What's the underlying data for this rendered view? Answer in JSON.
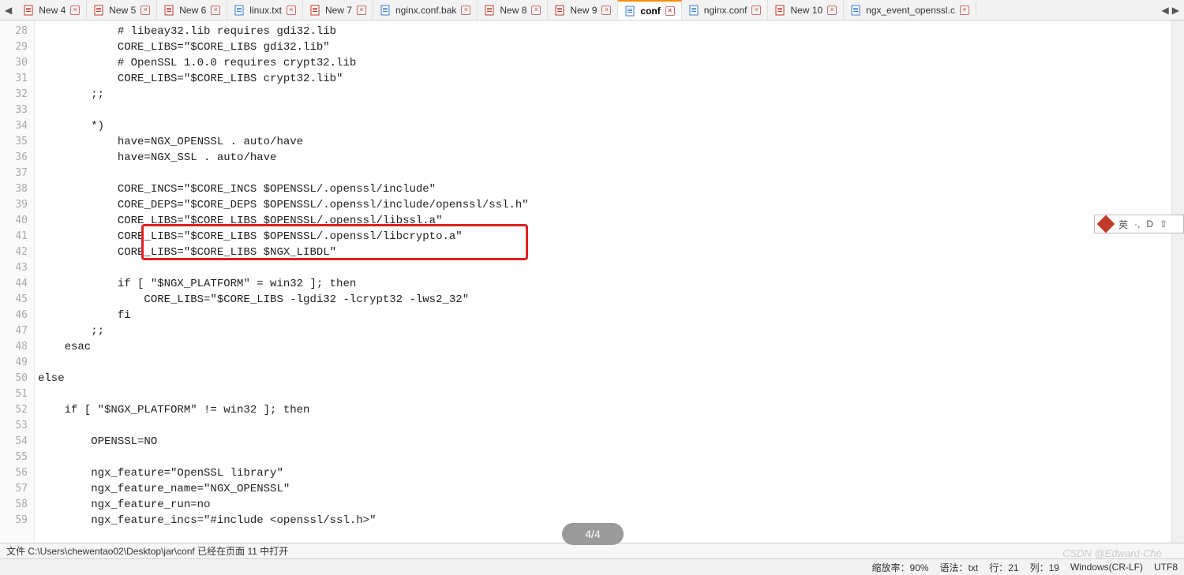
{
  "tabs": [
    {
      "label": "New 4",
      "icon": "red"
    },
    {
      "label": "New 5",
      "icon": "red"
    },
    {
      "label": "New 6",
      "icon": "red"
    },
    {
      "label": "linux.txt",
      "icon": "blue"
    },
    {
      "label": "New 7",
      "icon": "red"
    },
    {
      "label": "nginx.conf.bak",
      "icon": "blue"
    },
    {
      "label": "New 8",
      "icon": "red"
    },
    {
      "label": "New 9",
      "icon": "red"
    },
    {
      "label": "conf",
      "icon": "blue",
      "active": true
    },
    {
      "label": "nginx.conf",
      "icon": "blue"
    },
    {
      "label": "New 10",
      "icon": "red"
    },
    {
      "label": "ngx_event_openssl.c",
      "icon": "blue"
    }
  ],
  "first_line_number": 28,
  "code_lines": [
    "            # libeay32.lib requires gdi32.lib",
    "            CORE_LIBS=\"$CORE_LIBS gdi32.lib\"",
    "            # OpenSSL 1.0.0 requires crypt32.lib",
    "            CORE_LIBS=\"$CORE_LIBS crypt32.lib\"",
    "        ;;",
    "",
    "        *)",
    "            have=NGX_OPENSSL . auto/have",
    "            have=NGX_SSL . auto/have",
    "",
    "            CORE_INCS=\"$CORE_INCS $OPENSSL/.openssl/include\"",
    "            CORE_DEPS=\"$CORE_DEPS $OPENSSL/.openssl/include/openssl/ssl.h\"",
    "            CORE_LIBS=\"$CORE_LIBS $OPENSSL/.openssl/libssl.a\"",
    "            CORE_LIBS=\"$CORE_LIBS $OPENSSL/.openssl/libcrypto.a\"",
    "            CORE_LIBS=\"$CORE_LIBS $NGX_LIBDL\"",
    "",
    "            if [ \"$NGX_PLATFORM\" = win32 ]; then",
    "                CORE_LIBS=\"$CORE_LIBS -lgdi32 -lcrypt32 -lws2_32\"",
    "            fi",
    "        ;;",
    "    esac",
    "",
    "else",
    "",
    "    if [ \"$NGX_PLATFORM\" != win32 ]; then",
    "",
    "        OPENSSL=NO",
    "",
    "        ngx_feature=\"OpenSSL library\"",
    "        ngx_feature_name=\"NGX_OPENSSL\"",
    "        ngx_feature_run=no",
    "        ngx_feature_incs=\"#include <openssl/ssl.h>\""
  ],
  "search_pill": "4/4",
  "ime": {
    "lang": "英",
    "mode": "D"
  },
  "status1": "文件 C:\\Users\\chewentao02\\Desktop\\jar\\conf 已经在页面 11 中打开",
  "status2": {
    "zoom_label": "缩放率：",
    "zoom_value": "90%",
    "lang_label": "语法：",
    "lang_value": "txt",
    "line_label": "行：",
    "line_value": "21",
    "col_label": "列：",
    "col_value": "19",
    "eol": "Windows(CR-LF)",
    "enc": "UTF8"
  },
  "watermark": "CSDN @Edward·Che"
}
